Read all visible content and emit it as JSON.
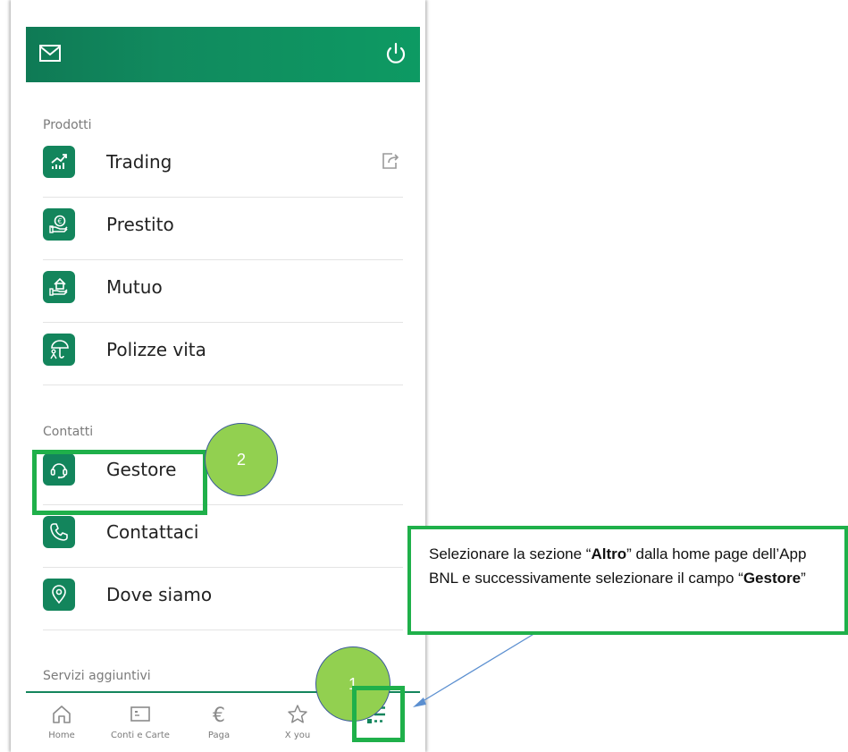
{
  "menu": {
    "sections": [
      {
        "title": "Prodotti"
      },
      {
        "title": "Contatti"
      },
      {
        "title": "Servizi aggiuntivi"
      }
    ],
    "items": [
      {
        "label": "Trading",
        "icon": "chart-growth-icon"
      },
      {
        "label": "Prestito",
        "icon": "hand-euro-icon"
      },
      {
        "label": "Mutuo",
        "icon": "hand-house-icon"
      },
      {
        "label": "Polizze vita",
        "icon": "umbrella-person-icon"
      },
      {
        "label": "Gestore",
        "icon": "headset-icon"
      },
      {
        "label": "Contattaci",
        "icon": "phone-icon"
      },
      {
        "label": "Dove siamo",
        "icon": "location-pin-icon"
      }
    ]
  },
  "nav": {
    "items": [
      {
        "label": "Home",
        "icon": "home-icon"
      },
      {
        "label": "Conti e Carte",
        "icon": "card-icon"
      },
      {
        "label": "Paga",
        "icon": "euro-icon"
      },
      {
        "label": "X you",
        "icon": "star-icon"
      },
      {
        "label": "",
        "icon": "list-menu-icon"
      }
    ]
  },
  "annotations": {
    "step1": "1",
    "step2": "2",
    "callout": {
      "part1": "Selezionare la sezione “",
      "bold1": "Altro",
      "part2": "” dalla home page dell’App BNL e successivamente selezionare il campo “",
      "bold2": "Gestore",
      "part3": "”"
    }
  },
  "colors": {
    "brand_green": "#13855c",
    "highlight_green": "#1fb04a",
    "step_circle": "#92d050"
  }
}
